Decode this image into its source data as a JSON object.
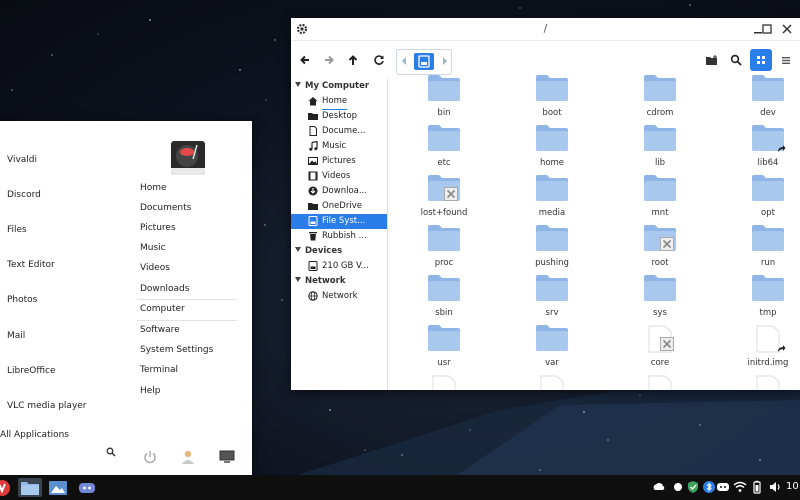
{
  "file_manager": {
    "title": "/",
    "sidebar": {
      "sections": [
        {
          "label": "My Computer"
        },
        {
          "label": "Devices"
        },
        {
          "label": "Network"
        }
      ],
      "my_computer": [
        {
          "label": "Home",
          "icon": "home-icon"
        },
        {
          "label": "Desktop",
          "icon": "desktop-folder-icon"
        },
        {
          "label": "Docume...",
          "icon": "document-icon"
        },
        {
          "label": "Music",
          "icon": "music-icon"
        },
        {
          "label": "Pictures",
          "icon": "pictures-icon"
        },
        {
          "label": "Videos",
          "icon": "videos-icon"
        },
        {
          "label": "Downloa...",
          "icon": "download-icon"
        },
        {
          "label": "OneDrive",
          "icon": "folder-icon"
        },
        {
          "label": "File Syst...",
          "icon": "drive-icon"
        },
        {
          "label": "Rubbish ...",
          "icon": "trash-icon"
        }
      ],
      "devices": [
        {
          "label": "210 GB V...",
          "icon": "drive-icon"
        }
      ],
      "network": [
        {
          "label": "Network",
          "icon": "network-icon"
        }
      ]
    },
    "items": [
      {
        "name": "bin",
        "kind": "folder"
      },
      {
        "name": "boot",
        "kind": "folder"
      },
      {
        "name": "cdrom",
        "kind": "folder"
      },
      {
        "name": "dev",
        "kind": "folder"
      },
      {
        "name": "etc",
        "kind": "folder"
      },
      {
        "name": "home",
        "kind": "folder"
      },
      {
        "name": "lib",
        "kind": "folder"
      },
      {
        "name": "lib64",
        "kind": "link-folder"
      },
      {
        "name": "lost+found",
        "kind": "locked-folder"
      },
      {
        "name": "media",
        "kind": "folder"
      },
      {
        "name": "mnt",
        "kind": "folder"
      },
      {
        "name": "opt",
        "kind": "folder"
      },
      {
        "name": "proc",
        "kind": "folder"
      },
      {
        "name": "pushing",
        "kind": "folder"
      },
      {
        "name": "root",
        "kind": "locked-folder"
      },
      {
        "name": "run",
        "kind": "folder"
      },
      {
        "name": "sbin",
        "kind": "folder"
      },
      {
        "name": "srv",
        "kind": "folder"
      },
      {
        "name": "sys",
        "kind": "folder"
      },
      {
        "name": "tmp",
        "kind": "folder"
      },
      {
        "name": "usr",
        "kind": "folder"
      },
      {
        "name": "var",
        "kind": "folder"
      },
      {
        "name": "core",
        "kind": "locked-file"
      },
      {
        "name": "initrd.img",
        "kind": "link-file"
      }
    ]
  },
  "menu": {
    "apps": [
      "Vivaldi",
      "Discord",
      "Files",
      "Text Editor",
      "Photos",
      "Mail",
      "LibreOffice",
      "VLC media player"
    ],
    "all_apps_label": "All Applications",
    "places": [
      "Home",
      "Documents",
      "Pictures",
      "Music",
      "Videos",
      "Downloads"
    ],
    "system": [
      "Computer",
      "Software",
      "System Settings",
      "Terminal",
      "Help"
    ]
  },
  "taskbar": {
    "clock": "10"
  },
  "colors": {
    "accent": "#2b7de9",
    "folder": "#a9c8ee",
    "folder_tab": "#8fb6e6"
  }
}
